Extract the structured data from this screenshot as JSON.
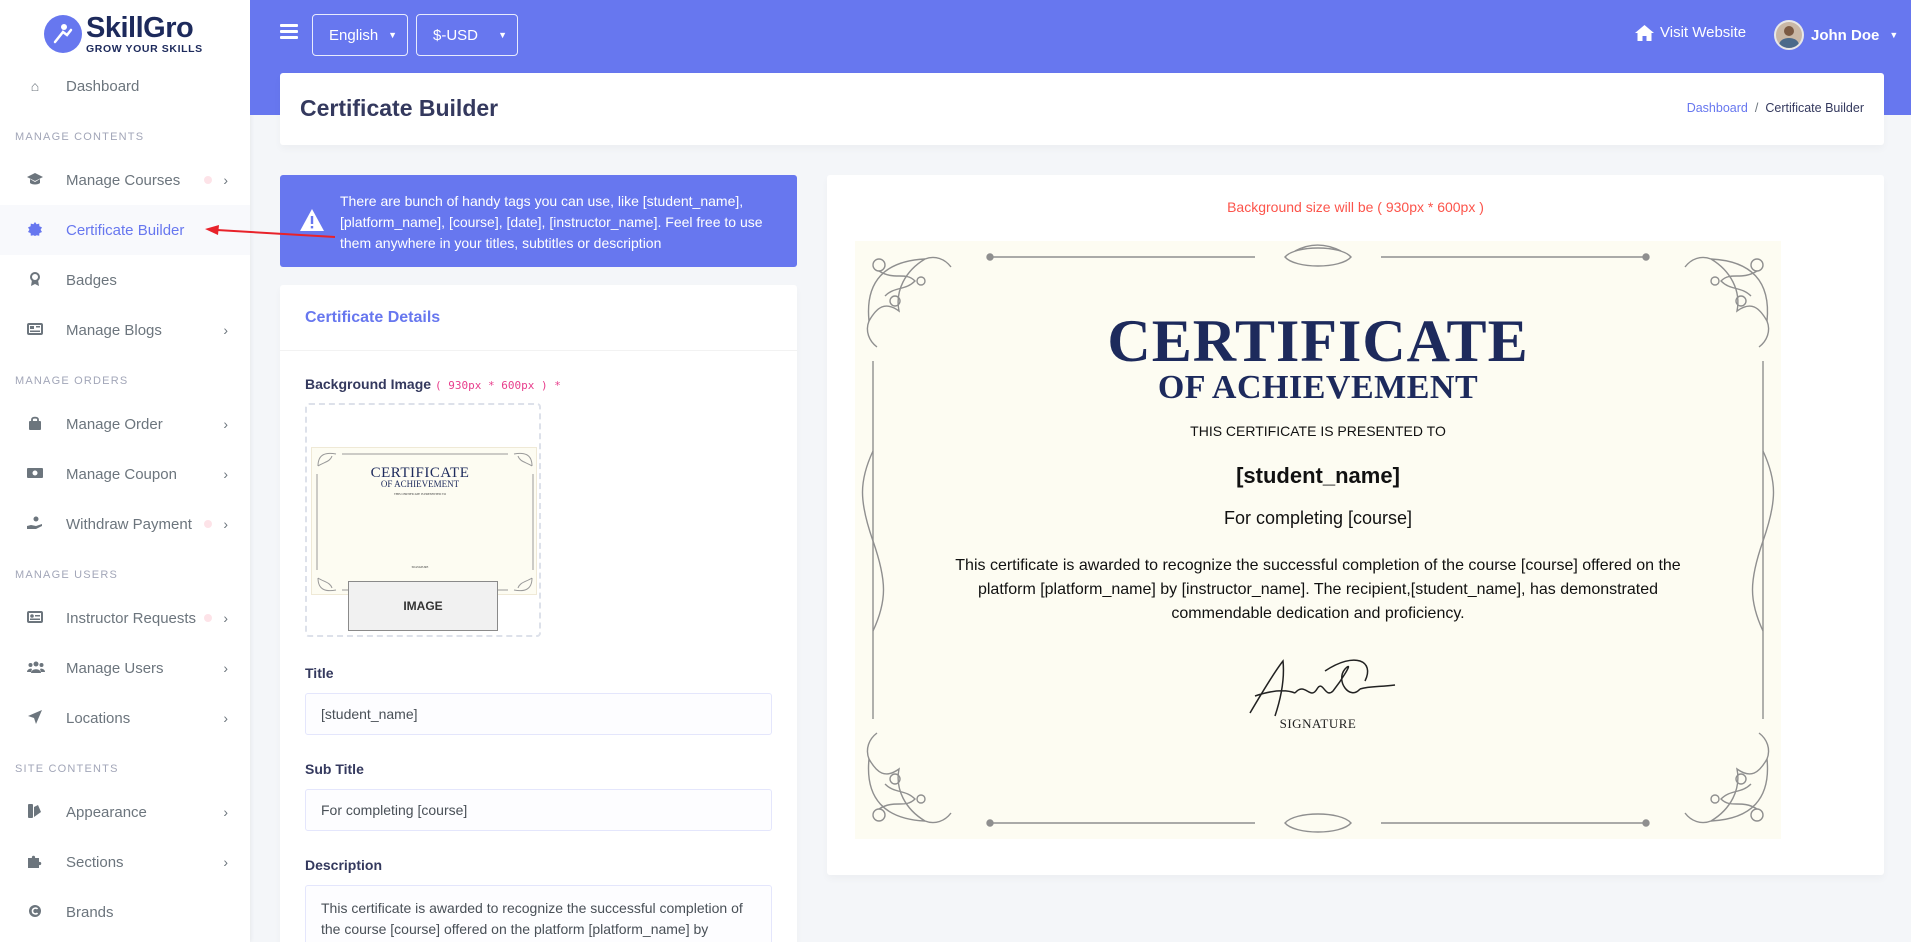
{
  "brand": {
    "name": "SkillGro",
    "tagline": "GROW YOUR SKILLS"
  },
  "sidebar": {
    "headers": {
      "manage_contents": "MANAGE CONTENTS",
      "manage_orders": "MANAGE ORDERS",
      "manage_users": "MANAGE USERS",
      "site_contents": "SITE CONTENTS"
    },
    "items": [
      {
        "label": "Dashboard",
        "icon": "home-icon"
      },
      {
        "label": "Manage Courses",
        "icon": "graduation-cap-icon"
      },
      {
        "label": "Certificate Builder",
        "icon": "certificate-icon",
        "active": true
      },
      {
        "label": "Badges",
        "icon": "award-icon"
      },
      {
        "label": "Manage Blogs",
        "icon": "newspaper-icon"
      },
      {
        "label": "Manage Order",
        "icon": "shopping-bag-icon"
      },
      {
        "label": "Manage Coupon",
        "icon": "money-icon"
      },
      {
        "label": "Withdraw Payment",
        "icon": "hand-coin-icon"
      },
      {
        "label": "Instructor Requests",
        "icon": "id-card-icon"
      },
      {
        "label": "Manage Users",
        "icon": "users-icon"
      },
      {
        "label": "Locations",
        "icon": "location-arrow-icon"
      },
      {
        "label": "Appearance",
        "icon": "paint-icon"
      },
      {
        "label": "Sections",
        "icon": "puzzle-icon"
      },
      {
        "label": "Brands",
        "icon": "copyright-icon"
      }
    ]
  },
  "topbar": {
    "language": "English",
    "currency": "$-USD",
    "visit_website": "Visit Website",
    "user_name": "John Doe"
  },
  "page": {
    "title": "Certificate Builder",
    "breadcrumb": {
      "home": "Dashboard",
      "separator": "/",
      "current": "Certificate Builder"
    }
  },
  "alert": {
    "message": "There are bunch of handy tags you can use, like [student_name], [platform_name], [course], [date], [instructor_name]. Feel free to use them anywhere in your titles, subtitles or description"
  },
  "form": {
    "card_title": "Certificate Details",
    "background_label": "Background Image",
    "background_hint": "( 930px * 600px ) *",
    "image_button": "IMAGE",
    "title_label": "Title",
    "title_value": "[student_name]",
    "subtitle_label": "Sub Title",
    "subtitle_value": "For completing [course]",
    "description_label": "Description",
    "description_value": "This certificate is awarded to recognize the successful completion of the course [course] offered on the platform [platform_name] by"
  },
  "preview": {
    "size_note": "Background size will be ( 930px * 600px )",
    "heading": "CERTIFICATE",
    "subheading": "OF ACHIEVEMENT",
    "presented": "THIS CERTIFICATE IS PRESENTED TO",
    "student": "[student_name]",
    "completing": "For completing [course]",
    "description": "This certificate is awarded to recognize the successful completion of the course [course] offered on the platform [platform_name] by [instructor_name]. The recipient,[student_name], has demonstrated commendable dedication and proficiency.",
    "signature_label": "SIGNATURE"
  },
  "colors": {
    "primary": "#6777ef",
    "danger": "#fc544b",
    "navy": "#1d2a5c",
    "arrow": "#e8222a"
  }
}
